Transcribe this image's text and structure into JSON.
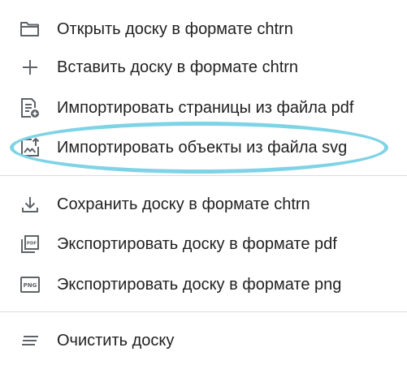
{
  "menu": {
    "items": [
      {
        "label": "Открыть доску в формате chtrn",
        "icon": "folder-open-icon"
      },
      {
        "label": "Вставить доску в формате chtrn",
        "icon": "plus-icon"
      },
      {
        "label": "Импортировать страницы из файла pdf",
        "icon": "document-add-icon"
      },
      {
        "label": "Импортировать объекты из файла svg",
        "icon": "image-upload-icon"
      },
      {
        "label": "Сохранить доску в формате chtrn",
        "icon": "download-icon"
      },
      {
        "label": "Экспортировать доску в формате pdf",
        "icon": "pdf-file-icon"
      },
      {
        "label": "Экспортировать доску в формате png",
        "icon": "png-file-icon"
      },
      {
        "label": "Очистить доску",
        "icon": "clear-lines-icon"
      }
    ],
    "icon_texts": {
      "pdf": "PDF",
      "png": "PNG"
    }
  },
  "colors": {
    "icon": "#5f6368",
    "text": "#212121",
    "divider": "#dcdcdc",
    "highlight_ring": "#7fd3e6"
  }
}
